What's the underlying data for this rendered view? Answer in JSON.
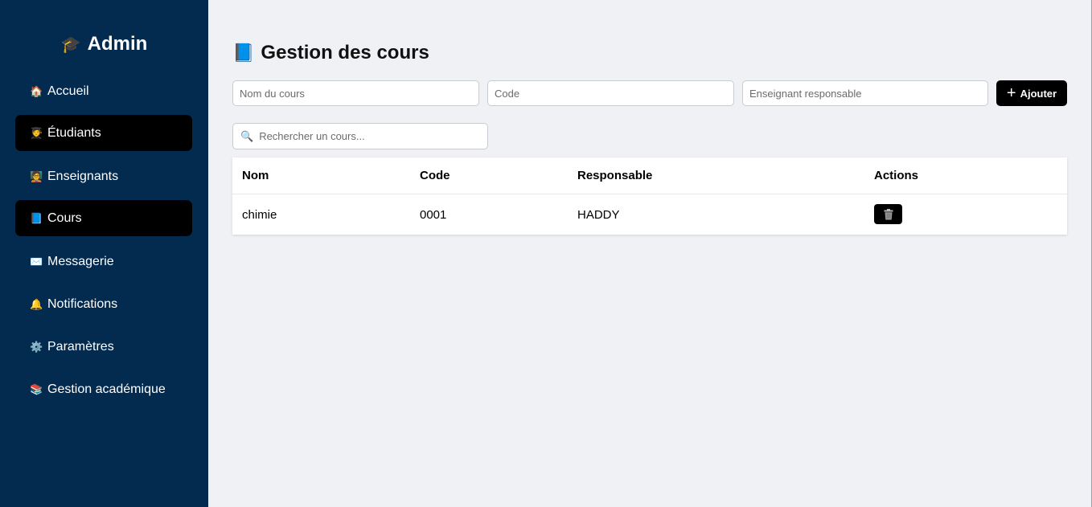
{
  "sidebar": {
    "brand": {
      "icon": "🎓",
      "title": "Admin"
    },
    "items": [
      {
        "icon": "🏠",
        "label": "Accueil",
        "active": false
      },
      {
        "icon": "🧑‍🎓",
        "label": "Étudiants",
        "active": true
      },
      {
        "icon": "🧑‍🏫",
        "label": "Enseignants",
        "active": false
      },
      {
        "icon": "📘",
        "label": "Cours",
        "active": true
      },
      {
        "icon": "✉️",
        "label": "Messagerie",
        "active": false
      },
      {
        "icon": "🔔",
        "label": "Notifications",
        "active": false
      },
      {
        "icon": "⚙️",
        "label": "Paramètres",
        "active": false
      },
      {
        "icon": "📚",
        "label": "Gestion académique",
        "active": false
      }
    ]
  },
  "main": {
    "title_icon": "📘",
    "title": "Gestion des cours",
    "form": {
      "course_name_placeholder": "Nom du cours",
      "code_placeholder": "Code",
      "teacher_placeholder": "Enseignant responsable",
      "add_label": "Ajouter",
      "add_icon": "+"
    },
    "search": {
      "icon": "🔍",
      "placeholder": "Rechercher un cours..."
    },
    "table": {
      "headers": {
        "name": "Nom",
        "code": "Code",
        "responsible": "Responsable",
        "actions": "Actions"
      },
      "rows": [
        {
          "name": "chimie",
          "code": "0001",
          "responsible": "HADDY",
          "action_icon": "trash-icon"
        }
      ]
    }
  },
  "colors": {
    "sidebar_bg": "#032a4f",
    "active_item_bg": "#000000",
    "page_bg": "#f0f1f5",
    "button_bg": "#000000"
  }
}
